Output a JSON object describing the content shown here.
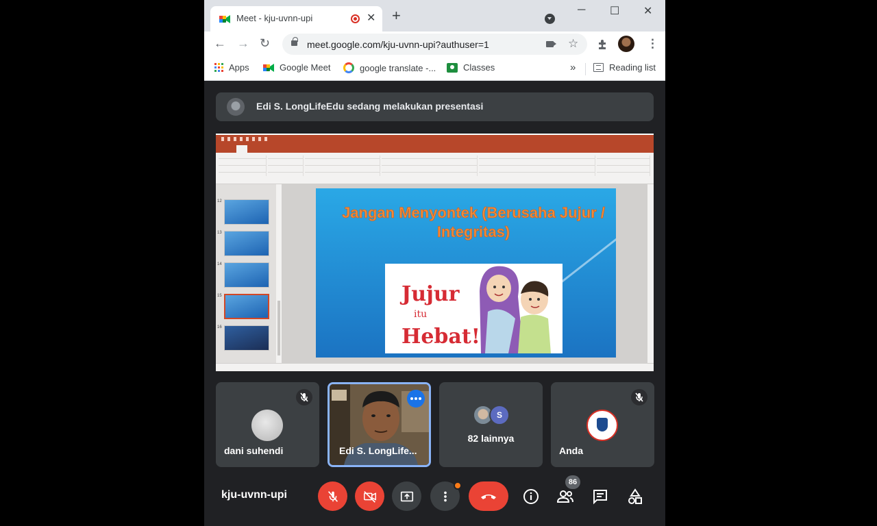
{
  "browser": {
    "tab_title": "Meet - kju-uvnn-upi",
    "url": "meet.google.com/kju-uvnn-upi?authuser=1",
    "window_controls": [
      "minimize",
      "maximize",
      "close"
    ],
    "bookmarks": [
      {
        "label": "Apps",
        "icon": "apps-grid-icon"
      },
      {
        "label": "Google Meet",
        "icon": "google-meet-icon"
      },
      {
        "label": "google translate -...",
        "icon": "google-icon"
      },
      {
        "label": "Classes",
        "icon": "classes-icon"
      }
    ],
    "reading_list": "Reading list"
  },
  "meet": {
    "presenter_banner": "Edi S. LongLifeEdu sedang melakukan presentasi",
    "slide": {
      "title": "Jangan Menyontek (Berusaha Jujur / Integritas)",
      "image_text_line1": "Jujur",
      "image_text_line2": "itu",
      "image_text_line3": "Hebat!",
      "slide_numbers": [
        "12",
        "13",
        "14",
        "15",
        "16"
      ]
    },
    "tiles": [
      {
        "name": "dani suhendi",
        "muted": true
      },
      {
        "name": "Edi S. LongLife...",
        "video": true
      },
      {
        "others_label": "82 lainnya",
        "avatar_letter": "S"
      },
      {
        "name": "Anda",
        "muted": true
      }
    ],
    "meeting_code": "kju-uvnn-upi",
    "participants_count": "86"
  },
  "colors": {
    "background": "#202124",
    "tile": "#3c4043",
    "danger": "#ea4335",
    "accent_blue": "#1a73e8",
    "powerpoint": "#b7472a"
  }
}
